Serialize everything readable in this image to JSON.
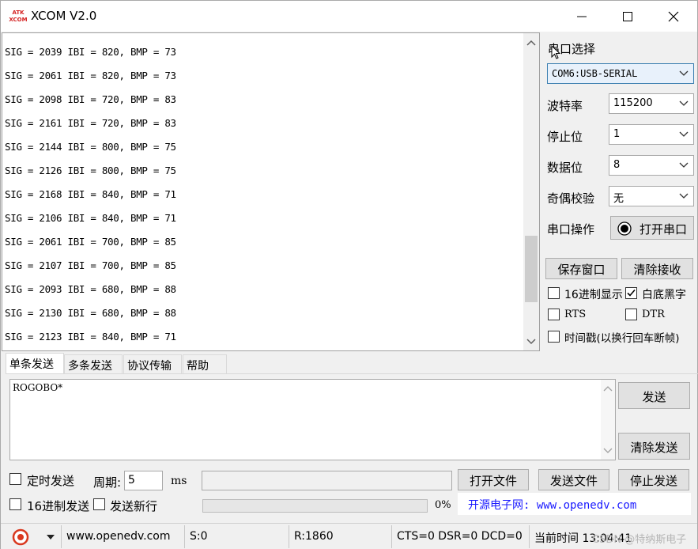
{
  "window": {
    "title": "XCOM V2.0",
    "logo_text": "ATK XCOM"
  },
  "receive": {
    "lines": [
      "SIG = 2039 IBI = 820, BMP = 73",
      "SIG = 2061 IBI = 820, BMP = 73",
      "SIG = 2098 IBI = 720, BMP = 83",
      "SIG = 2161 IBI = 720, BMP = 83",
      "SIG = 2144 IBI = 800, BMP = 75",
      "SIG = 2126 IBI = 800, BMP = 75",
      "SIG = 2168 IBI = 840, BMP = 71",
      "SIG = 2106 IBI = 840, BMP = 71",
      "SIG = 2061 IBI = 700, BMP = 85",
      "SIG = 2107 IBI = 700, BMP = 85",
      "SIG = 2093 IBI = 680, BMP = 88",
      "SIG = 2130 IBI = 680, BMP = 88",
      "SIG = 2123 IBI = 840, BMP = 71"
    ]
  },
  "settings": {
    "port_select_label": "串口选择",
    "port_value": "COM6:USB-SERIAL",
    "baud_label": "波特率",
    "baud_value": "115200",
    "stop_label": "停止位",
    "stop_value": "1",
    "data_label": "数据位",
    "data_value": "8",
    "parity_label": "奇偶校验",
    "parity_value": "无",
    "port_op_label": "串口操作",
    "open_port_label": "打开串口",
    "save_window_label": "保存窗口",
    "clear_recv_label": "清除接收",
    "hex_display_label": "16进制显示",
    "hex_display_checked": false,
    "white_black_label": "白底黑字",
    "white_black_checked": true,
    "rts_label": "RTS",
    "rts_checked": false,
    "dtr_label": "DTR",
    "dtr_checked": false,
    "timestamp_label": "时间戳(以换行回车断帧)",
    "timestamp_checked": false
  },
  "tabs": [
    "单条发送",
    "多条发送",
    "协议传输",
    "帮助"
  ],
  "send": {
    "text": "ROGOBO*",
    "send_label": "发送",
    "clear_send_label": "清除发送",
    "timed_send_label": "定时发送",
    "timed_send_checked": false,
    "period_label": "周期:",
    "period_value": "5",
    "period_unit": "ms",
    "open_file_label": "打开文件",
    "send_file_label": "发送文件",
    "stop_send_label": "停止发送",
    "hex_send_label": "16进制发送",
    "hex_send_checked": false,
    "newline_label": "发送新行",
    "newline_checked": false,
    "progress_text": "0%",
    "progress_value": 0,
    "site_text": "开源电子网: www.openedv.com"
  },
  "status": {
    "url": "www.openedv.com",
    "sent": "S:0",
    "received": "R:1860",
    "lines": "CTS=0 DSR=0 DCD=0",
    "time": "当前时间 13:04:41",
    "watermark": "CSDN @特纳斯电子"
  },
  "colors": {
    "link": "#1a1aff",
    "logo_red": "#d42020",
    "status_icon": "#d9381e"
  }
}
